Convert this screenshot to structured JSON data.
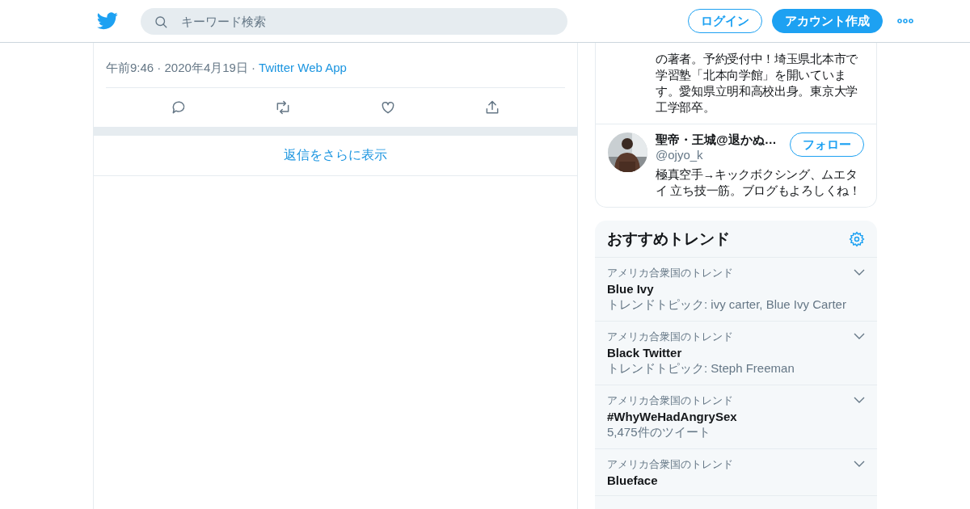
{
  "header": {
    "search": {
      "placeholder": "キーワード検索"
    },
    "login": "ログイン",
    "signup": "アカウント作成"
  },
  "tweet": {
    "time": "午前9:46 · 2020年4月19日",
    "separator": "·",
    "source": "Twitter Web App",
    "more_replies": "返信をさらに表示"
  },
  "people": [
    {
      "bio": "の著者。予約受付中！埼玉県北本市で学習塾「北本向学館」を開いています。愛知県立明和高校出身。東京大学工学部卒。"
    },
    {
      "name": "聖帝・王城@退かぬ…",
      "handle": "@ojyo_k",
      "follow": "フォロー",
      "bio": "極真空手→キックボクシング、ムエタイ 立ち技一筋。ブログもよろしくね！"
    }
  ],
  "trends": {
    "title": "おすすめトレンド",
    "items": [
      {
        "context": "アメリカ合衆国のトレンド",
        "name": "Blue Ivy",
        "detail": "トレンドトピック: ivy carter, Blue Ivy Carter"
      },
      {
        "context": "アメリカ合衆国のトレンド",
        "name": "Black Twitter",
        "detail": "トレンドトピック: Steph Freeman"
      },
      {
        "context": "アメリカ合衆国のトレンド",
        "name": "#WhyWeHadAngrySex",
        "detail": "5,475件のツイート"
      },
      {
        "context": "アメリカ合衆国のトレンド",
        "name": "Blueface"
      }
    ]
  }
}
